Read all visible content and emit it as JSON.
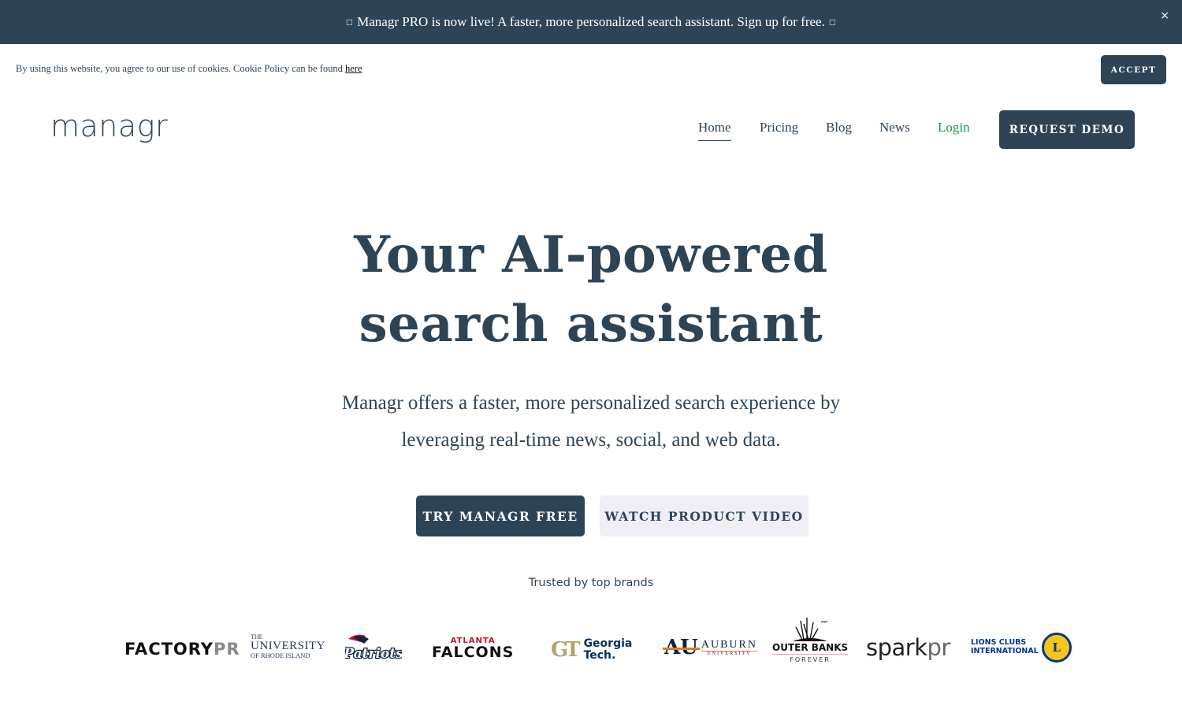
{
  "announcement": {
    "prefix_glyph": "□",
    "text": "Managr PRO is now live! A faster, more personalized search assistant. Sign up for free.",
    "suffix_glyph": "□",
    "close_icon": "×"
  },
  "cookie_notice": {
    "text": "By using this website, you agree to our use of cookies. Cookie Policy can be found ",
    "link_label": "here",
    "accept_label": "ACCEPT"
  },
  "header": {
    "logo": "managr",
    "nav": [
      {
        "label": "Home",
        "active": true
      },
      {
        "label": "Pricing"
      },
      {
        "label": "Blog"
      },
      {
        "label": "News"
      },
      {
        "label": "Login",
        "color": "#1a9650"
      }
    ],
    "cta_label": "REQUEST DEMO"
  },
  "hero": {
    "title_line1": "Your AI-powered",
    "title_line2": "search assistant",
    "subtitle_line1": "Managr offers a faster, more personalized search experience by",
    "subtitle_line2": "leveraging real-time news, social, and web data.",
    "primary_cta": "TRY MANAGR FREE",
    "secondary_cta": "WATCH PRODUCT VIDEO"
  },
  "brands": {
    "heading": "Trusted by top brands",
    "logos": {
      "factorypr": {
        "a": "FACTORY",
        "b": "PR"
      },
      "uri": {
        "l1": "THE",
        "l2": "UNIVERSITY",
        "l3": "OF RHODE ISLAND"
      },
      "patriots": {
        "name": "Patriots"
      },
      "falcons": {
        "l1": "ATLANTA",
        "l2": "FALCONS"
      },
      "georgia_tech": {
        "mark": "GT",
        "l1": "Georgia",
        "l2": "Tech."
      },
      "auburn": {
        "mark": "AU",
        "l1": "AUBURN",
        "l2": "UNIVERSITY"
      },
      "outer_banks": {
        "l1": "OUTER BANKS",
        "l2": "FOREVER"
      },
      "sparkpr": {
        "a": "spark",
        "b": "pr"
      },
      "lions": {
        "l1": "LIONS CLUBS",
        "l2": "INTERNATIONAL",
        "mark": "L"
      }
    }
  },
  "colors": {
    "brand_navy": "#2d4456",
    "login_green": "#1a9650",
    "secondary_button_bg": "#efeef5"
  }
}
